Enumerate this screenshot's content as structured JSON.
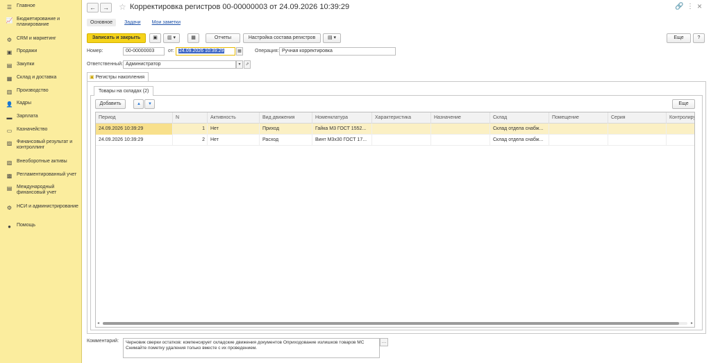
{
  "sidebar": {
    "items": [
      {
        "label": "Главное",
        "icon": "menu-icon",
        "glyph": "☰"
      },
      {
        "label": "Бюджетирование и планирование",
        "icon": "chart-icon",
        "glyph": "📈"
      },
      {
        "label": "CRM и маркетинг",
        "icon": "crm-icon",
        "glyph": "⚙"
      },
      {
        "label": "Продажи",
        "icon": "sales-icon",
        "glyph": "▣"
      },
      {
        "label": "Закупки",
        "icon": "purchases-icon",
        "glyph": "▤"
      },
      {
        "label": "Склад и доставка",
        "icon": "warehouse-icon",
        "glyph": "▦"
      },
      {
        "label": "Производство",
        "icon": "factory-icon",
        "glyph": "▥"
      },
      {
        "label": "Кадры",
        "icon": "people-icon",
        "glyph": "👤"
      },
      {
        "label": "Зарплата",
        "icon": "salary-icon",
        "glyph": "▬"
      },
      {
        "label": "Казначейство",
        "icon": "treasury-icon",
        "glyph": "▭"
      },
      {
        "label": "Финансовый результат и контроллинг",
        "icon": "finance-icon",
        "glyph": "▨"
      },
      {
        "label": "Внеоборотные активы",
        "icon": "assets-icon",
        "glyph": "▧"
      },
      {
        "label": "Регламентированный учет",
        "icon": "accounting-icon",
        "glyph": "▩"
      },
      {
        "label": "Международный финансовый учет",
        "icon": "intl-icon",
        "glyph": "▤"
      },
      {
        "label": "НСИ и администрирование",
        "icon": "settings-icon",
        "glyph": "⚙"
      },
      {
        "label": "Помощь",
        "icon": "help-icon",
        "glyph": "●"
      }
    ]
  },
  "header": {
    "title": "Корректировка регистров 00-00000003 от 24.09.2026 10:39:29",
    "back": "←",
    "forward": "→",
    "star": "☆",
    "link_icon": "🔗",
    "more_icon": "⋮",
    "close_icon": "×"
  },
  "tabs": [
    {
      "label": "Основное"
    },
    {
      "label": "Задачи"
    },
    {
      "label": "Мои заметки"
    }
  ],
  "toolbar": {
    "save_close": "Записать и закрыть",
    "save_glyph": "▣",
    "create_glyph": "▥ ▾",
    "post_glyph": "▦",
    "reports": "Отчеты",
    "configure": "Настройка состава регистров",
    "extra_glyph": "▤ ▾",
    "more": "Еще",
    "help": "?"
  },
  "form": {
    "number_label": "Номер:",
    "number_value": "00-00000003",
    "date_label": "от:",
    "date_value": "24.09.2026 10:39:29",
    "operation_label": "Операция:",
    "operation_value": "Ручная корректировка",
    "responsible_label": "Ответственный:",
    "responsible_value": "Администратор",
    "comment_label": "Комментарий:",
    "comment_value": "Черновик сверки остатков: компенсирует складские движения документов Оприходование излишков товаров МС Снимайте пометку удаления только вместе с их проведением."
  },
  "registers": {
    "group_label": "Регистры накопления",
    "tab_label": "Товары на складах (2)",
    "add_button": "Добавить",
    "up": "▲",
    "down": "▼",
    "more": "Еще",
    "columns": [
      "Период",
      "N",
      "Активность",
      "Вид движения",
      "Номенклатура",
      "Характеристика",
      "Назначение",
      "Склад",
      "Помещение",
      "Серия",
      "Контролиру"
    ],
    "rows": [
      [
        "24.09.2026 10:39:29",
        "1",
        "Нет",
        "Приход",
        "Гайка М3 ГОСТ 1552...",
        "",
        "",
        "Склад отдела снабж...",
        "",
        "",
        ""
      ],
      [
        "24.09.2026 10:39:29",
        "2",
        "Нет",
        "Расход",
        "Винт М3x30 ГОСТ 17...",
        "",
        "",
        "Склад отдела снабж...",
        "",
        "",
        ""
      ]
    ]
  }
}
